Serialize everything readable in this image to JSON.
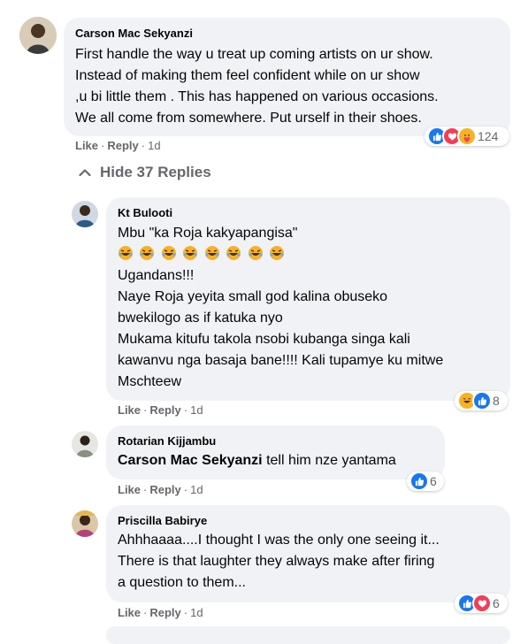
{
  "comments": [
    {
      "author": "Carson Mac Sekyanzi",
      "lines": [
        "First handle the way u treat up coming artists on ur show.",
        "Instead of making them feel confident while on ur show",
        ",u bi little them . This has happened on various occasions.",
        "We all come from somewhere. Put urself in their shoes."
      ],
      "like_label": "Like",
      "reply_label": "Reply",
      "time": "1d",
      "reaction_count": "124",
      "reaction_icons": [
        "like-icon",
        "love-icon",
        "care-icon"
      ]
    }
  ],
  "hide_replies_label": "Hide 37 Replies",
  "replies": [
    {
      "author": "Kt Bulooti",
      "lines": [
        "Mbu \"ka Roja kakyapangisa\"",
        "Ugandans!!!",
        "Naye Roja yeyita small god kalina obuseko",
        "bwekilogo as if katuka nyo",
        "Mukama kitufu takola nsobi kubanga singa kali",
        "kawanvu nga basaja bane!!!! Kali tupamye ku mitwe",
        "Mschteew"
      ],
      "emoji_row_count": 8,
      "like_label": "Like",
      "reply_label": "Reply",
      "time": "1d",
      "reaction_count": "8",
      "reaction_icons": [
        "haha-icon",
        "like-icon"
      ]
    },
    {
      "author": "Rotarian Kijjambu",
      "mention": "Carson Mac Sekyanzi",
      "text_after_mention": " tell him nze yantama",
      "like_label": "Like",
      "reply_label": "Reply",
      "time": "1d",
      "reaction_count": "6",
      "reaction_icons": [
        "like-icon"
      ]
    },
    {
      "author": "Priscilla Babirye",
      "lines": [
        "Ahhhaaaa....I thought I was the only one seeing it...",
        "There is that laughter they always make after firing",
        "a question to them..."
      ],
      "like_label": "Like",
      "reply_label": "Reply",
      "time": "1d",
      "reaction_count": "6",
      "reaction_icons": [
        "like-icon",
        "love-icon"
      ]
    }
  ],
  "colors": {
    "bubble": "#f0f2f5",
    "secondary_text": "#65676b",
    "like_blue": "#1877f2",
    "love_red": "#f33e58",
    "reaction_yellow": "#f7b125"
  }
}
